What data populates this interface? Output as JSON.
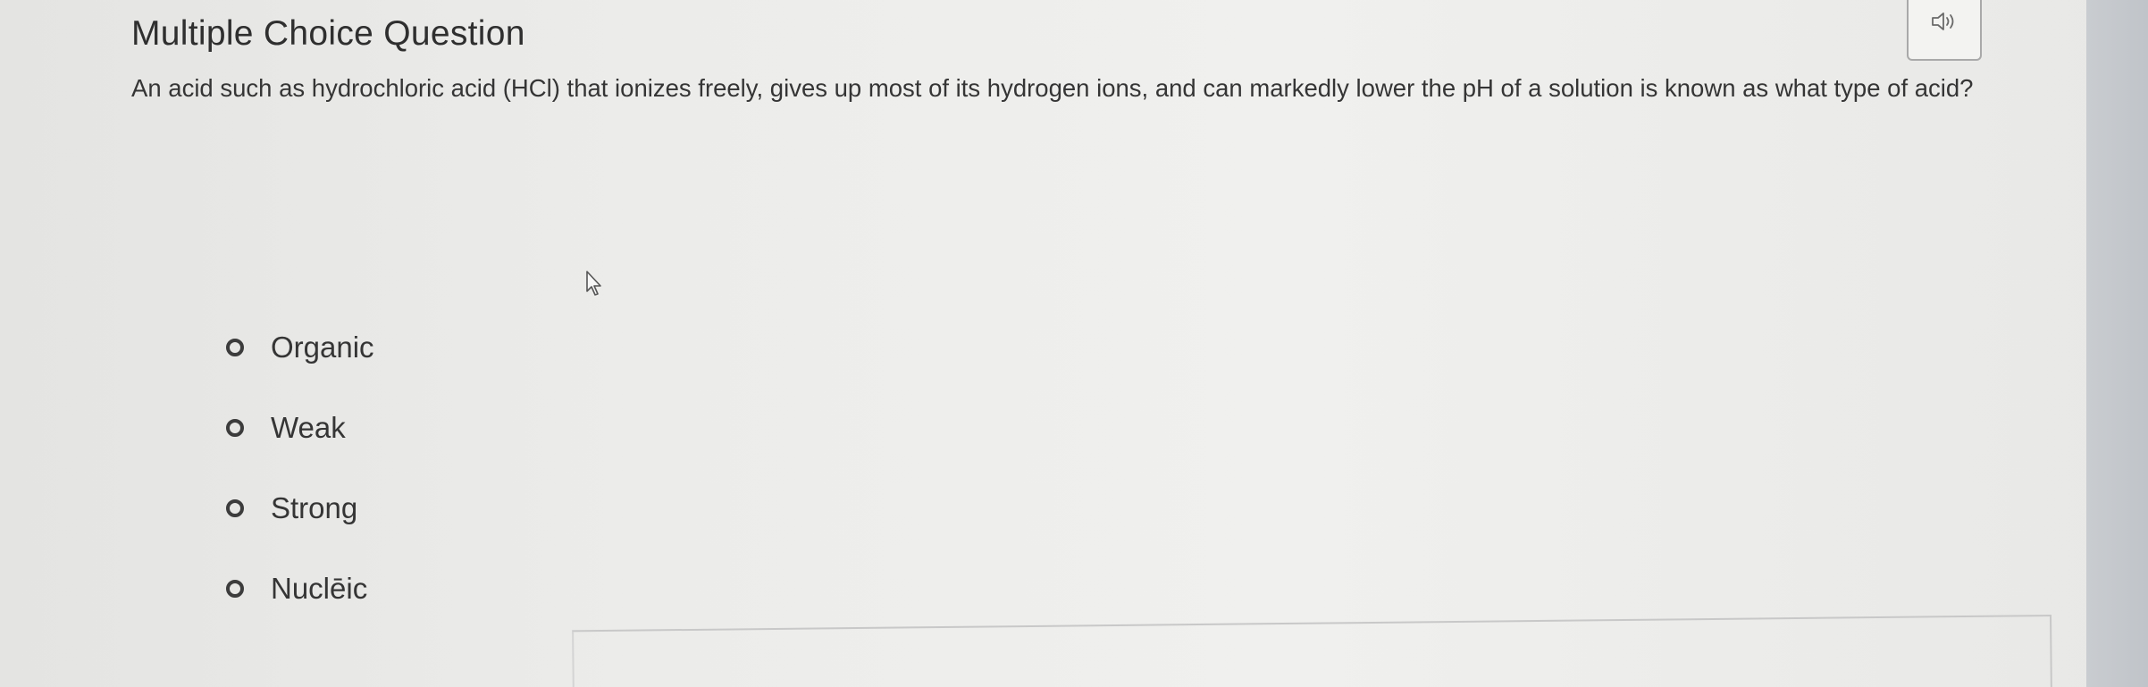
{
  "page": {
    "title": "Multiple Choice Question"
  },
  "audio_button": {
    "icon": "speaker-icon"
  },
  "question": {
    "text": "An acid such as hydrochloric acid (HCl) that ionizes freely, gives up most of its hydrogen ions, and can markedly lower the pH of a solution is known as what type of acid?"
  },
  "choices": [
    {
      "label": "Organic",
      "selected": false
    },
    {
      "label": "Weak",
      "selected": false
    },
    {
      "label": "Strong",
      "selected": false
    },
    {
      "label": "Nuclēic",
      "selected": false
    }
  ],
  "colors": {
    "text": "#353535",
    "background": "#ececea",
    "radio_border": "#3c3c3c"
  }
}
